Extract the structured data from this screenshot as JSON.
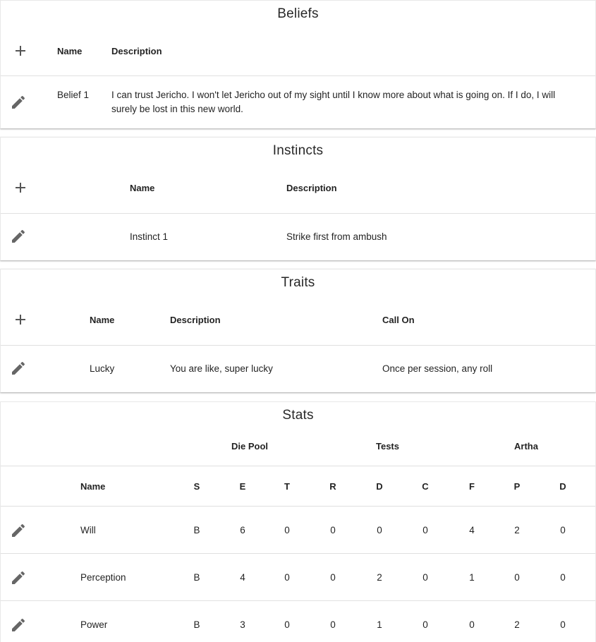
{
  "beliefs": {
    "title": "Beliefs",
    "columns": {
      "name": "Name",
      "description": "Description"
    },
    "rows": [
      {
        "name": "Belief 1",
        "description": "I can trust Jericho. I won't let Jericho out of my sight until I know more about what is going on. If I do, I will surely be lost in this new world."
      }
    ]
  },
  "instincts": {
    "title": "Instincts",
    "columns": {
      "name": "Name",
      "description": "Description"
    },
    "rows": [
      {
        "name": "Instinct 1",
        "description": "Strike first from ambush"
      }
    ]
  },
  "traits": {
    "title": "Traits",
    "columns": {
      "name": "Name",
      "description": "Description",
      "call_on": "Call On"
    },
    "rows": [
      {
        "name": "Lucky",
        "description": "You are like, super lucky",
        "call_on": "Once per session, any roll"
      }
    ]
  },
  "stats": {
    "title": "Stats",
    "groups": {
      "die_pool": "Die Pool",
      "tests": "Tests",
      "artha": "Artha"
    },
    "columns": {
      "name": "Name",
      "s": "S",
      "e": "E",
      "t": "T",
      "r": "R",
      "d": "D",
      "c": "C",
      "f": "F",
      "p": "P",
      "d2": "D"
    },
    "rows": [
      {
        "name": "Will",
        "s": "B",
        "e": "6",
        "t": "0",
        "r": "0",
        "d": "0",
        "c": "0",
        "f": "4",
        "p": "2",
        "d2": "0"
      },
      {
        "name": "Perception",
        "s": "B",
        "e": "4",
        "t": "0",
        "r": "0",
        "d": "2",
        "c": "0",
        "f": "1",
        "p": "0",
        "d2": "0"
      },
      {
        "name": "Power",
        "s": "B",
        "e": "3",
        "t": "0",
        "r": "0",
        "d": "1",
        "c": "0",
        "f": "0",
        "p": "2",
        "d2": "0"
      }
    ]
  },
  "icons": {
    "add": "plus-icon",
    "edit": "pencil-icon"
  }
}
